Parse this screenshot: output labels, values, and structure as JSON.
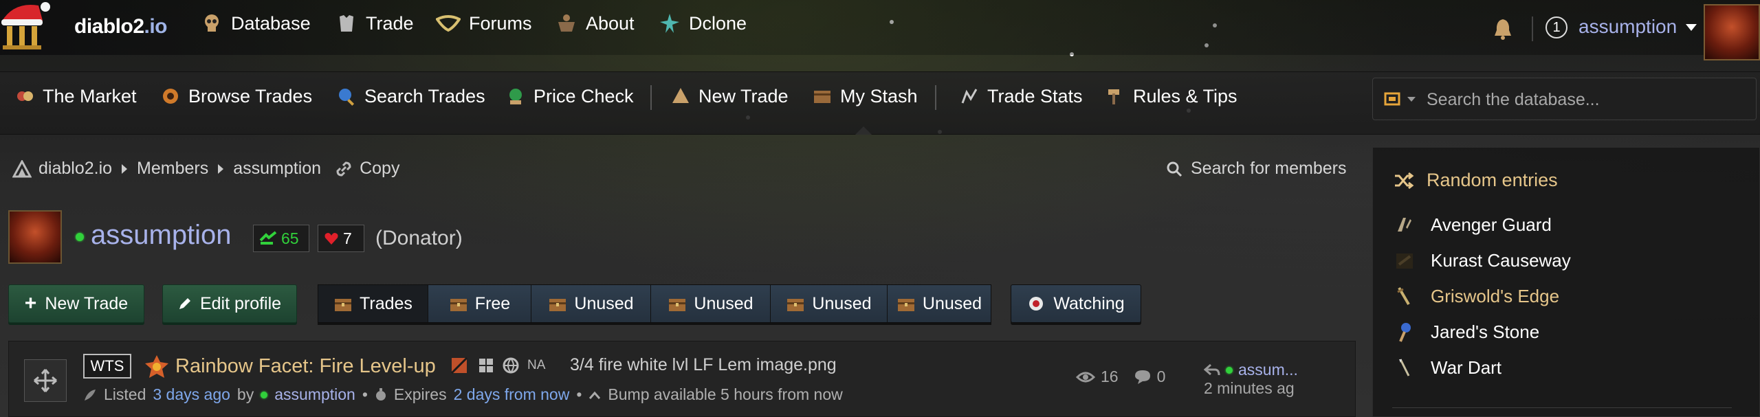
{
  "brand": {
    "name": "diablo2",
    "tld": ".io"
  },
  "top_nav": [
    {
      "label": "Database",
      "icon": "skull-icon"
    },
    {
      "label": "Trade",
      "icon": "armor-icon"
    },
    {
      "label": "Forums",
      "icon": "horn-icon"
    },
    {
      "label": "About",
      "icon": "cauldron-icon"
    },
    {
      "label": "Dclone",
      "icon": "spirit-icon"
    }
  ],
  "user_menu": {
    "notification_count": "1",
    "username": "assumption"
  },
  "sub_nav": [
    {
      "label": "The Market",
      "icon": "market-icon"
    },
    {
      "label": "Browse Trades",
      "icon": "browse-icon"
    },
    {
      "label": "Search Trades",
      "icon": "search-trades-icon"
    },
    {
      "label": "Price Check",
      "icon": "price-check-icon"
    },
    {
      "label": "New Trade",
      "icon": "new-trade-icon"
    },
    {
      "label": "My Stash",
      "icon": "stash-icon"
    },
    {
      "label": "Trade Stats",
      "icon": "stats-icon"
    },
    {
      "label": "Rules & Tips",
      "icon": "hammer-icon"
    }
  ],
  "search": {
    "placeholder": "Search the database..."
  },
  "breadcrumb": {
    "home": "diablo2.io",
    "section": "Members",
    "current": "assumption",
    "copy": "Copy"
  },
  "search_members": "Search for members",
  "profile": {
    "username": "assumption",
    "trade_rep": "65",
    "likes": "7",
    "rank": "(Donator)"
  },
  "actions": {
    "new_trade": "New Trade",
    "edit_profile": "Edit profile"
  },
  "tabs": [
    {
      "label": "Trades",
      "active": true
    },
    {
      "label": "Free"
    },
    {
      "label": "Unused"
    },
    {
      "label": "Unused"
    },
    {
      "label": "Unused"
    },
    {
      "label": "Unused"
    }
  ],
  "watching": "Watching",
  "listing": {
    "type": "WTS",
    "item_name": "Rainbow Facet: Fire Level-up",
    "region": "NA",
    "description": "3/4 fire white lvl LF Lem image.png",
    "listed_label": "Listed",
    "listed_time": "3 days ago",
    "by_label": "by",
    "seller": "assumption",
    "expires_label": "Expires",
    "expires_time": "2 days from now",
    "bump_text": "Bump available 5 hours from now",
    "views": "16",
    "comments": "0",
    "last_reply_user": "assum...",
    "last_reply_time": "2 minutes ag",
    "separator": "•"
  },
  "sidebar": {
    "title": "Random entries",
    "items": [
      {
        "label": "Avenger Guard",
        "color": "#ffffff"
      },
      {
        "label": "Kurast Causeway",
        "color": "#ffffff"
      },
      {
        "label": "Griswold's Edge",
        "color": "#e6c68a"
      },
      {
        "label": "Jared's Stone",
        "color": "#ffffff"
      },
      {
        "label": "War Dart",
        "color": "#ffffff"
      }
    ]
  },
  "colors": {
    "accent_blue": "#a8b2ea",
    "unique_gold": "#e6c68a",
    "link_blue": "#7fa8ec",
    "online_green": "#31d13b",
    "button_green": "#2c5a40"
  }
}
